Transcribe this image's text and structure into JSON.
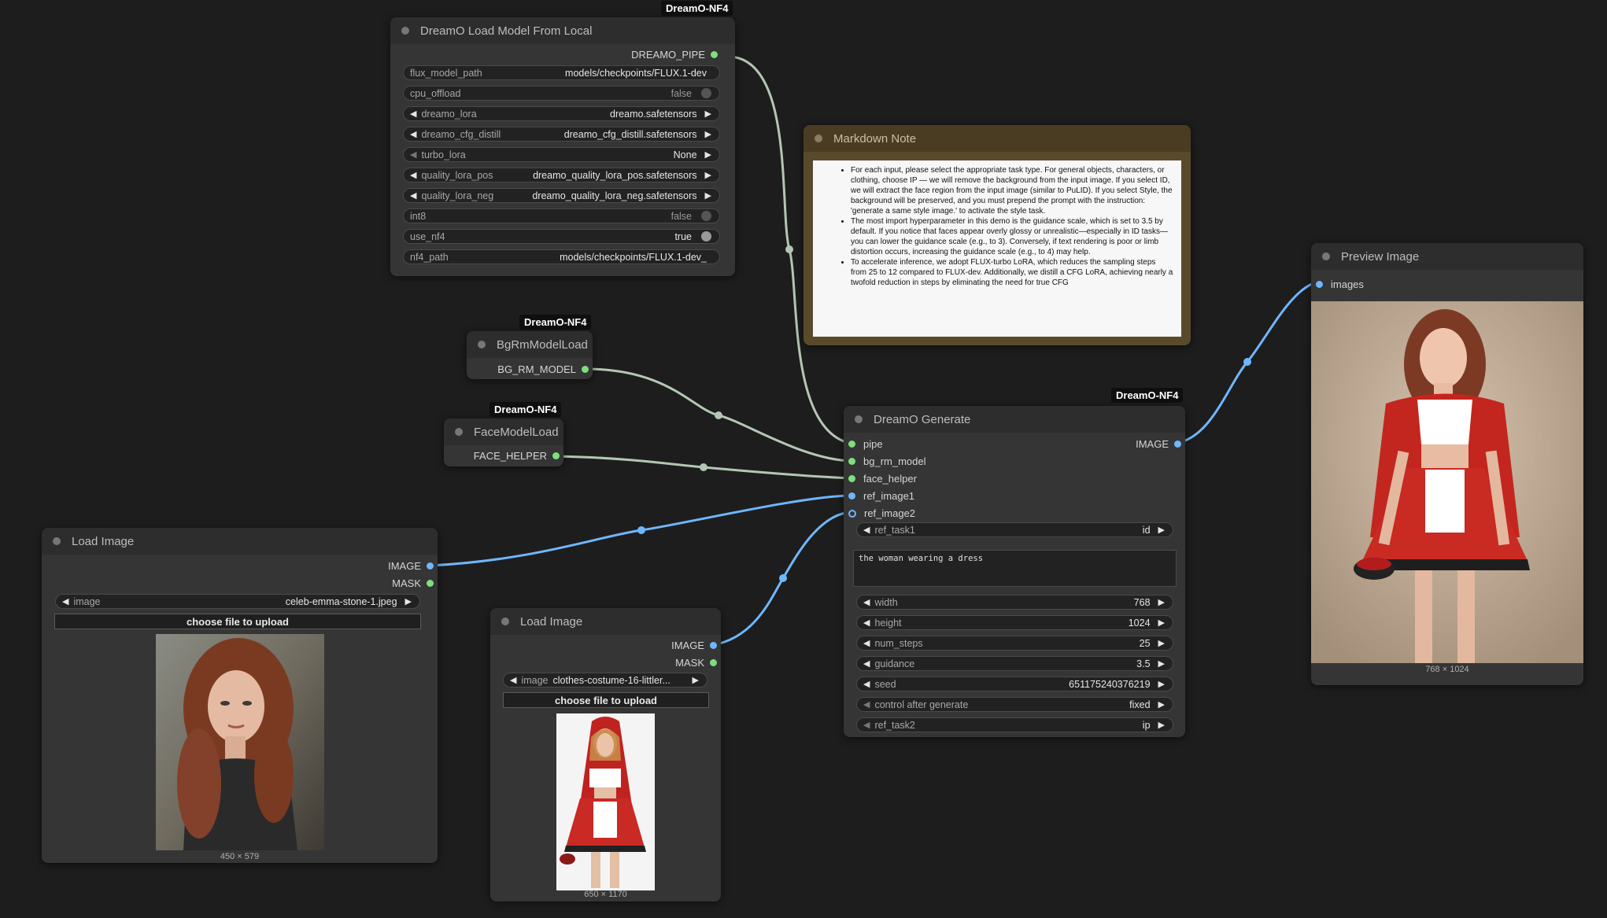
{
  "colors": {
    "canvas": "#1d1d1d",
    "node_body": "#353535",
    "node_title": "#2d2d2d",
    "wire_pipe": "#b3c7b3",
    "wire_image": "#6fb6ff",
    "socket_green": "#7ddf7d",
    "socket_blue": "#6fb6ff",
    "note_frame": "#5a4a2c",
    "note_title": "#4a3c22"
  },
  "badges": {
    "load_model": "DreamO-NF4",
    "bgrm": "DreamO-NF4",
    "face": "DreamO-NF4",
    "generate": "DreamO-NF4"
  },
  "load_model": {
    "title": "DreamO Load Model From Local",
    "output": "DREAMO_PIPE",
    "widgets": [
      {
        "label": "flux_model_path",
        "value": "models/checkpoints/FLUX.1-dev"
      },
      {
        "label": "cpu_offload",
        "value": "false"
      },
      {
        "label": "dreamo_lora",
        "value": "dreamo.safetensors"
      },
      {
        "label": "dreamo_cfg_distill",
        "value": "dreamo_cfg_distill.safetensors"
      },
      {
        "label": "turbo_lora",
        "value": "None"
      },
      {
        "label": "quality_lora_pos",
        "value": "dreamo_quality_lora_pos.safetensors"
      },
      {
        "label": "quality_lora_neg",
        "value": "dreamo_quality_lora_neg.safetensors"
      },
      {
        "label": "int8",
        "value": "false"
      },
      {
        "label": "use_nf4",
        "value": "true"
      },
      {
        "label": "nf4_path",
        "value": "models/checkpoints/FLUX.1-dev_"
      }
    ]
  },
  "bgrm": {
    "title": "BgRmModelLoad",
    "output": "BG_RM_MODEL"
  },
  "face": {
    "title": "FaceModelLoad",
    "output": "FACE_HELPER"
  },
  "note": {
    "title": "Markdown Note",
    "items": [
      "For each input, please select the appropriate task type. For general objects, characters, or clothing, choose IP — we will remove the background from the input image. If you select ID, we will extract the face region from the input image (similar to PuLID). If you select Style, the background will be preserved, and you must prepend the prompt with the instruction: 'generate a same style image.' to activate the style task.",
      "The most import hyperparameter in this demo is the guidance scale, which is set to 3.5 by default. If you notice that faces appear overly glossy or unrealistic—especially in ID tasks—you can lower the guidance scale (e.g., to 3). Conversely, if text rendering is poor or limb distortion occurs, increasing the guidance scale (e.g., to 4) may help.",
      "To accelerate inference, we adopt FLUX-turbo LoRA, which reduces the sampling steps from 25 to 12 compared to FLUX-dev. Additionally, we distill a CFG LoRA, achieving nearly a twofold reduction in steps by eliminating the need for true CFG"
    ]
  },
  "generate": {
    "title": "DreamO Generate",
    "inputs": [
      "pipe",
      "bg_rm_model",
      "face_helper",
      "ref_image1",
      "ref_image2"
    ],
    "output": "IMAGE",
    "ref_task1": {
      "label": "ref_task1",
      "value": "id"
    },
    "prompt": "the woman wearing a dress",
    "widgets": [
      {
        "label": "width",
        "value": "768"
      },
      {
        "label": "height",
        "value": "1024"
      },
      {
        "label": "num_steps",
        "value": "25"
      },
      {
        "label": "guidance",
        "value": "3.5"
      },
      {
        "label": "seed",
        "value": "651175240376219"
      },
      {
        "label": "control after generate",
        "value": "fixed"
      },
      {
        "label": "ref_task2",
        "value": "ip"
      }
    ]
  },
  "load_image_1": {
    "title": "Load Image",
    "outputs": [
      "IMAGE",
      "MASK"
    ],
    "image_label": "image",
    "image_value": "celeb-emma-stone-1.jpeg",
    "upload": "choose file to upload",
    "caption": "450 × 579"
  },
  "load_image_2": {
    "title": "Load Image",
    "outputs": [
      "IMAGE",
      "MASK"
    ],
    "image_label": "image",
    "image_value": "clothes-costume-16-littler...",
    "upload": "choose file to upload",
    "caption": "650 × 1170"
  },
  "preview": {
    "title": "Preview Image",
    "input": "images",
    "caption": "768 × 1024"
  }
}
